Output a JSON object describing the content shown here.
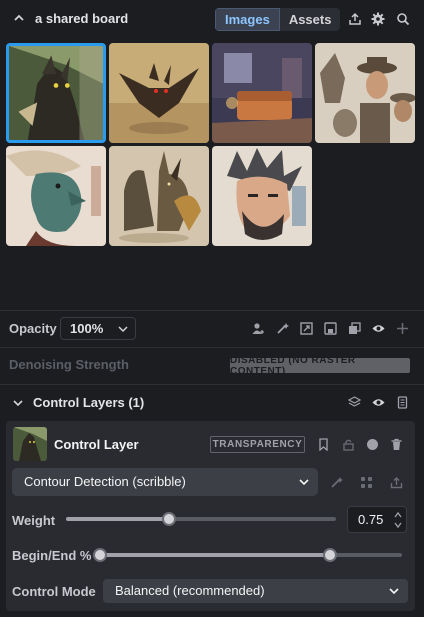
{
  "board": {
    "title": "a shared board"
  },
  "tabs": [
    {
      "label": "Images",
      "active": true
    },
    {
      "label": "Assets",
      "active": false
    }
  ],
  "gallery": {
    "images": [
      {
        "name": "werewolf-portrait",
        "selected": true
      },
      {
        "name": "winged-beast",
        "selected": false
      },
      {
        "name": "cozy-room",
        "selected": false
      },
      {
        "name": "cowboy-figures",
        "selected": false
      },
      {
        "name": "green-face-profile",
        "selected": false
      },
      {
        "name": "horned-creatures",
        "selected": false
      },
      {
        "name": "bearded-man-sketch",
        "selected": false
      }
    ]
  },
  "opacity": {
    "label": "Opacity",
    "value": "100%"
  },
  "denoising": {
    "label": "Denoising Strength",
    "badge": "DISABLED (NO RASTER CONTENT)"
  },
  "control_layers": {
    "title": "Control Layers (1)",
    "layer": {
      "name": "Control Layer",
      "badge": "TRANSPARENCY",
      "model": "Contour Detection (scribble)",
      "weight": {
        "label": "Weight",
        "value": "0.75",
        "fraction": 0.38
      },
      "begin_end": {
        "label": "Begin/End %",
        "begin": 0,
        "end": 0.76
      },
      "control_mode": {
        "label": "Control Mode",
        "value": "Balanced (recommended)"
      }
    }
  },
  "colors": {
    "accent": "#2a9cf0",
    "tab_active_text": "#8ec5ff"
  }
}
